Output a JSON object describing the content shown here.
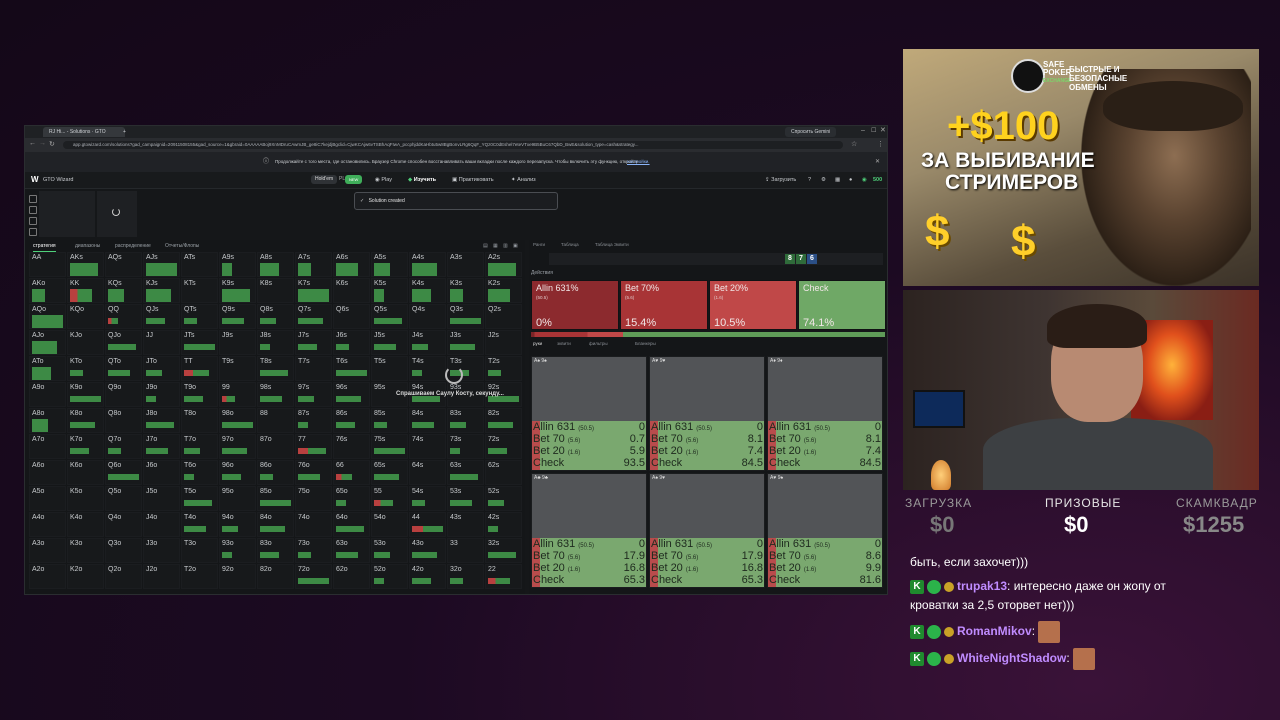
{
  "browser": {
    "tabs": [
      "RJ Hi... - Solutions · GTO Wiz...",
      "+"
    ],
    "profile_button": "Спросить Gemini",
    "url": "app.gtowizard.com/solutions?gad_campaignid=20911508155&gad_source=1&gbraid=0AAAAABoj9XnMDruCAwmJB_ge8iC7kejdjBgclid=CjwKCAjw6vTSBhAqFIwA_pccphjddKaHbtu5w8BgBonvLRg6QqF_YQz0C0dEshel7eteVTxe9B5BuC67QbD_BwE&solution_type=cash&strategy..."
  },
  "infobar": {
    "text": "Продолжайте с того места, где остановились. Браузер Chrome способен восстанавливать ваши вкладки после каждого перезапуска. Чтобы включить эту функцию, откройте",
    "link": "настройки."
  },
  "app": {
    "logo_text": "GTO Wizard",
    "mode_label": "Hold'em",
    "plo_label": "PLO",
    "plo_badge": "NEW",
    "nav": [
      "Play",
      "Изучить",
      "Практиковать",
      "Анализ"
    ],
    "upload_label": "Загрузить",
    "credits": "500",
    "toast": "Solution created",
    "subtabs": [
      "стратегия",
      "диапазоны",
      "распределение",
      "Отчеты/Флопы"
    ],
    "loading_text": "Спрашиваем Саулу Косту, секунду..."
  },
  "matrix": {
    "rows": [
      [
        "AA",
        "AKs",
        "AQs",
        "AJs",
        "ATs",
        "A9s",
        "A8s",
        "A7s",
        "A6s",
        "A5s",
        "A4s",
        "A3s",
        "A2s"
      ],
      [
        "AKo",
        "KK",
        "KQs",
        "KJs",
        "KTs",
        "K9s",
        "K8s",
        "K7s",
        "K6s",
        "K5s",
        "K4s",
        "K3s",
        "K2s"
      ],
      [
        "AQo",
        "KQo",
        "QQ",
        "QJs",
        "QTs",
        "Q9s",
        "Q8s",
        "Q7s",
        "Q6s",
        "Q5s",
        "Q4s",
        "Q3s",
        "Q2s"
      ],
      [
        "AJo",
        "KJo",
        "QJo",
        "JJ",
        "JTs",
        "J9s",
        "J8s",
        "J7s",
        "J6s",
        "J5s",
        "J4s",
        "J3s",
        "J2s"
      ],
      [
        "ATo",
        "KTo",
        "QTo",
        "JTo",
        "TT",
        "T9s",
        "T8s",
        "T7s",
        "T6s",
        "T5s",
        "T4s",
        "T3s",
        "T2s"
      ],
      [
        "A9o",
        "K9o",
        "Q9o",
        "J9o",
        "T9o",
        "99",
        "98s",
        "97s",
        "96s",
        "95s",
        "94s",
        "93s",
        "92s"
      ],
      [
        "A8o",
        "K8o",
        "Q8o",
        "J8o",
        "T8o",
        "98o",
        "88",
        "87s",
        "86s",
        "85s",
        "84s",
        "83s",
        "82s"
      ],
      [
        "A7o",
        "K7o",
        "Q7o",
        "J7o",
        "T7o",
        "97o",
        "87o",
        "77",
        "76s",
        "75s",
        "74s",
        "73s",
        "72s"
      ],
      [
        "A6o",
        "K6o",
        "Q6o",
        "J6o",
        "T6o",
        "96o",
        "86o",
        "76o",
        "66",
        "65s",
        "64s",
        "63s",
        "62s"
      ],
      [
        "A5o",
        "K5o",
        "Q5o",
        "J5o",
        "T5o",
        "95o",
        "85o",
        "75o",
        "65o",
        "55",
        "54s",
        "53s",
        "52s"
      ],
      [
        "A4o",
        "K4o",
        "Q4o",
        "J4o",
        "T4o",
        "94o",
        "84o",
        "74o",
        "64o",
        "54o",
        "44",
        "43s",
        "42s"
      ],
      [
        "A3o",
        "K3o",
        "Q3o",
        "J3o",
        "T3o",
        "93o",
        "83o",
        "73o",
        "63o",
        "53o",
        "43o",
        "33",
        "32s"
      ],
      [
        "A2o",
        "K2o",
        "Q2o",
        "J2o",
        "T2o",
        "92o",
        "82o",
        "72o",
        "62o",
        "52o",
        "42o",
        "32o",
        "22"
      ]
    ]
  },
  "analysis": {
    "tabs": [
      "Ранги",
      "Таблица",
      "Таблица Эквити"
    ],
    "board": [
      "8",
      "7",
      "6"
    ],
    "actions_label": "Действия",
    "tabs2": [
      "руки",
      "эквити",
      "фильтры",
      "Бланкеры"
    ],
    "actions": [
      {
        "name": "Allin 631%",
        "sub": "(50.5)",
        "pct": "0%",
        "color": "#8c2a2e"
      },
      {
        "name": "Bet 70%",
        "sub": "(5.6)",
        "pct": "15.4%",
        "color": "#a83436"
      },
      {
        "name": "Bet 20%",
        "sub": "(1.6)",
        "pct": "10.5%",
        "color": "#c04848"
      },
      {
        "name": "Check",
        "sub": "",
        "pct": "74.1%",
        "color": "#6fa866"
      }
    ],
    "combos": [
      {
        "head": "A♠ 9♠",
        "rows": [
          [
            "Allin 631",
            "(50.5)",
            "0"
          ],
          [
            "Bet 70",
            "(5.6)",
            "0.7"
          ],
          [
            "Bet 20",
            "(1.6)",
            "5.9"
          ],
          [
            "Check",
            "",
            "93.5"
          ]
        ]
      },
      {
        "head": "A♥ 9♥",
        "rows": [
          [
            "Allin 631",
            "(50.5)",
            "0"
          ],
          [
            "Bet 70",
            "(5.6)",
            "8.1"
          ],
          [
            "Bet 20",
            "(1.6)",
            "7.4"
          ],
          [
            "Check",
            "",
            "84.5"
          ]
        ]
      },
      {
        "head": "A♦ 9♦",
        "rows": [
          [
            "Allin 631",
            "(50.5)",
            "0"
          ],
          [
            "Bet 70",
            "(5.6)",
            "8.1"
          ],
          [
            "Bet 20",
            "(1.6)",
            "7.4"
          ],
          [
            "Check",
            "",
            "84.5"
          ]
        ]
      },
      {
        "head": "A♣ 9♣",
        "rows": [
          [
            "Allin 631",
            "(50.5)",
            "0"
          ],
          [
            "Bet 70",
            "(5.6)",
            "17.9"
          ],
          [
            "Bet 20",
            "(1.6)",
            "16.8"
          ],
          [
            "Check",
            "",
            "65.3"
          ]
        ]
      },
      {
        "head": "A♠ 9♥",
        "rows": [
          [
            "Allin 631",
            "(50.5)",
            "0"
          ],
          [
            "Bet 70",
            "(5.6)",
            "17.9"
          ],
          [
            "Bet 20",
            "(1.6)",
            "16.8"
          ],
          [
            "Check",
            "",
            "65.3"
          ]
        ]
      },
      {
        "head": "A♥ 9♠",
        "rows": [
          [
            "Allin 631",
            "(50.5)",
            "0"
          ],
          [
            "Bet 70",
            "(5.6)",
            "8.6"
          ],
          [
            "Bet 20",
            "(1.6)",
            "9.9"
          ],
          [
            "Check",
            "",
            "81.6"
          ]
        ]
      }
    ]
  },
  "ad": {
    "brand_line1": "SAFE",
    "brand_line2": "POKER",
    "brand_line3": "EXCHANGE",
    "slogan": "БЫСТРЫЕ И БЕЗОПАСНЫЕ ОБМЕНЫ",
    "amount": "+$100",
    "line1": "ЗА ВЫБИВАНИЕ",
    "line2": "СТРИМЕРОВ",
    "dollar": "$"
  },
  "stats": [
    {
      "label": "ЗАГРУЗКА",
      "value": "$0"
    },
    {
      "label": "ПРИЗОВЫЕ",
      "value": "$0"
    },
    {
      "label": "СКАМКВАДР",
      "value": "$1255"
    }
  ],
  "chat": {
    "lines": [
      {
        "text": "быть, если захочет)))"
      },
      {
        "user": "trupak13",
        "user_color": "#c08cff",
        "message": "интересно даже он жопу от",
        "cont": "кроватки за 2,5 оторвет нет)))"
      },
      {
        "user": "RomanMikov",
        "user_color": "#c08cff",
        "message": ""
      },
      {
        "user": "WhiteNightShadow",
        "user_color": "#c08cff",
        "message": ""
      }
    ]
  }
}
